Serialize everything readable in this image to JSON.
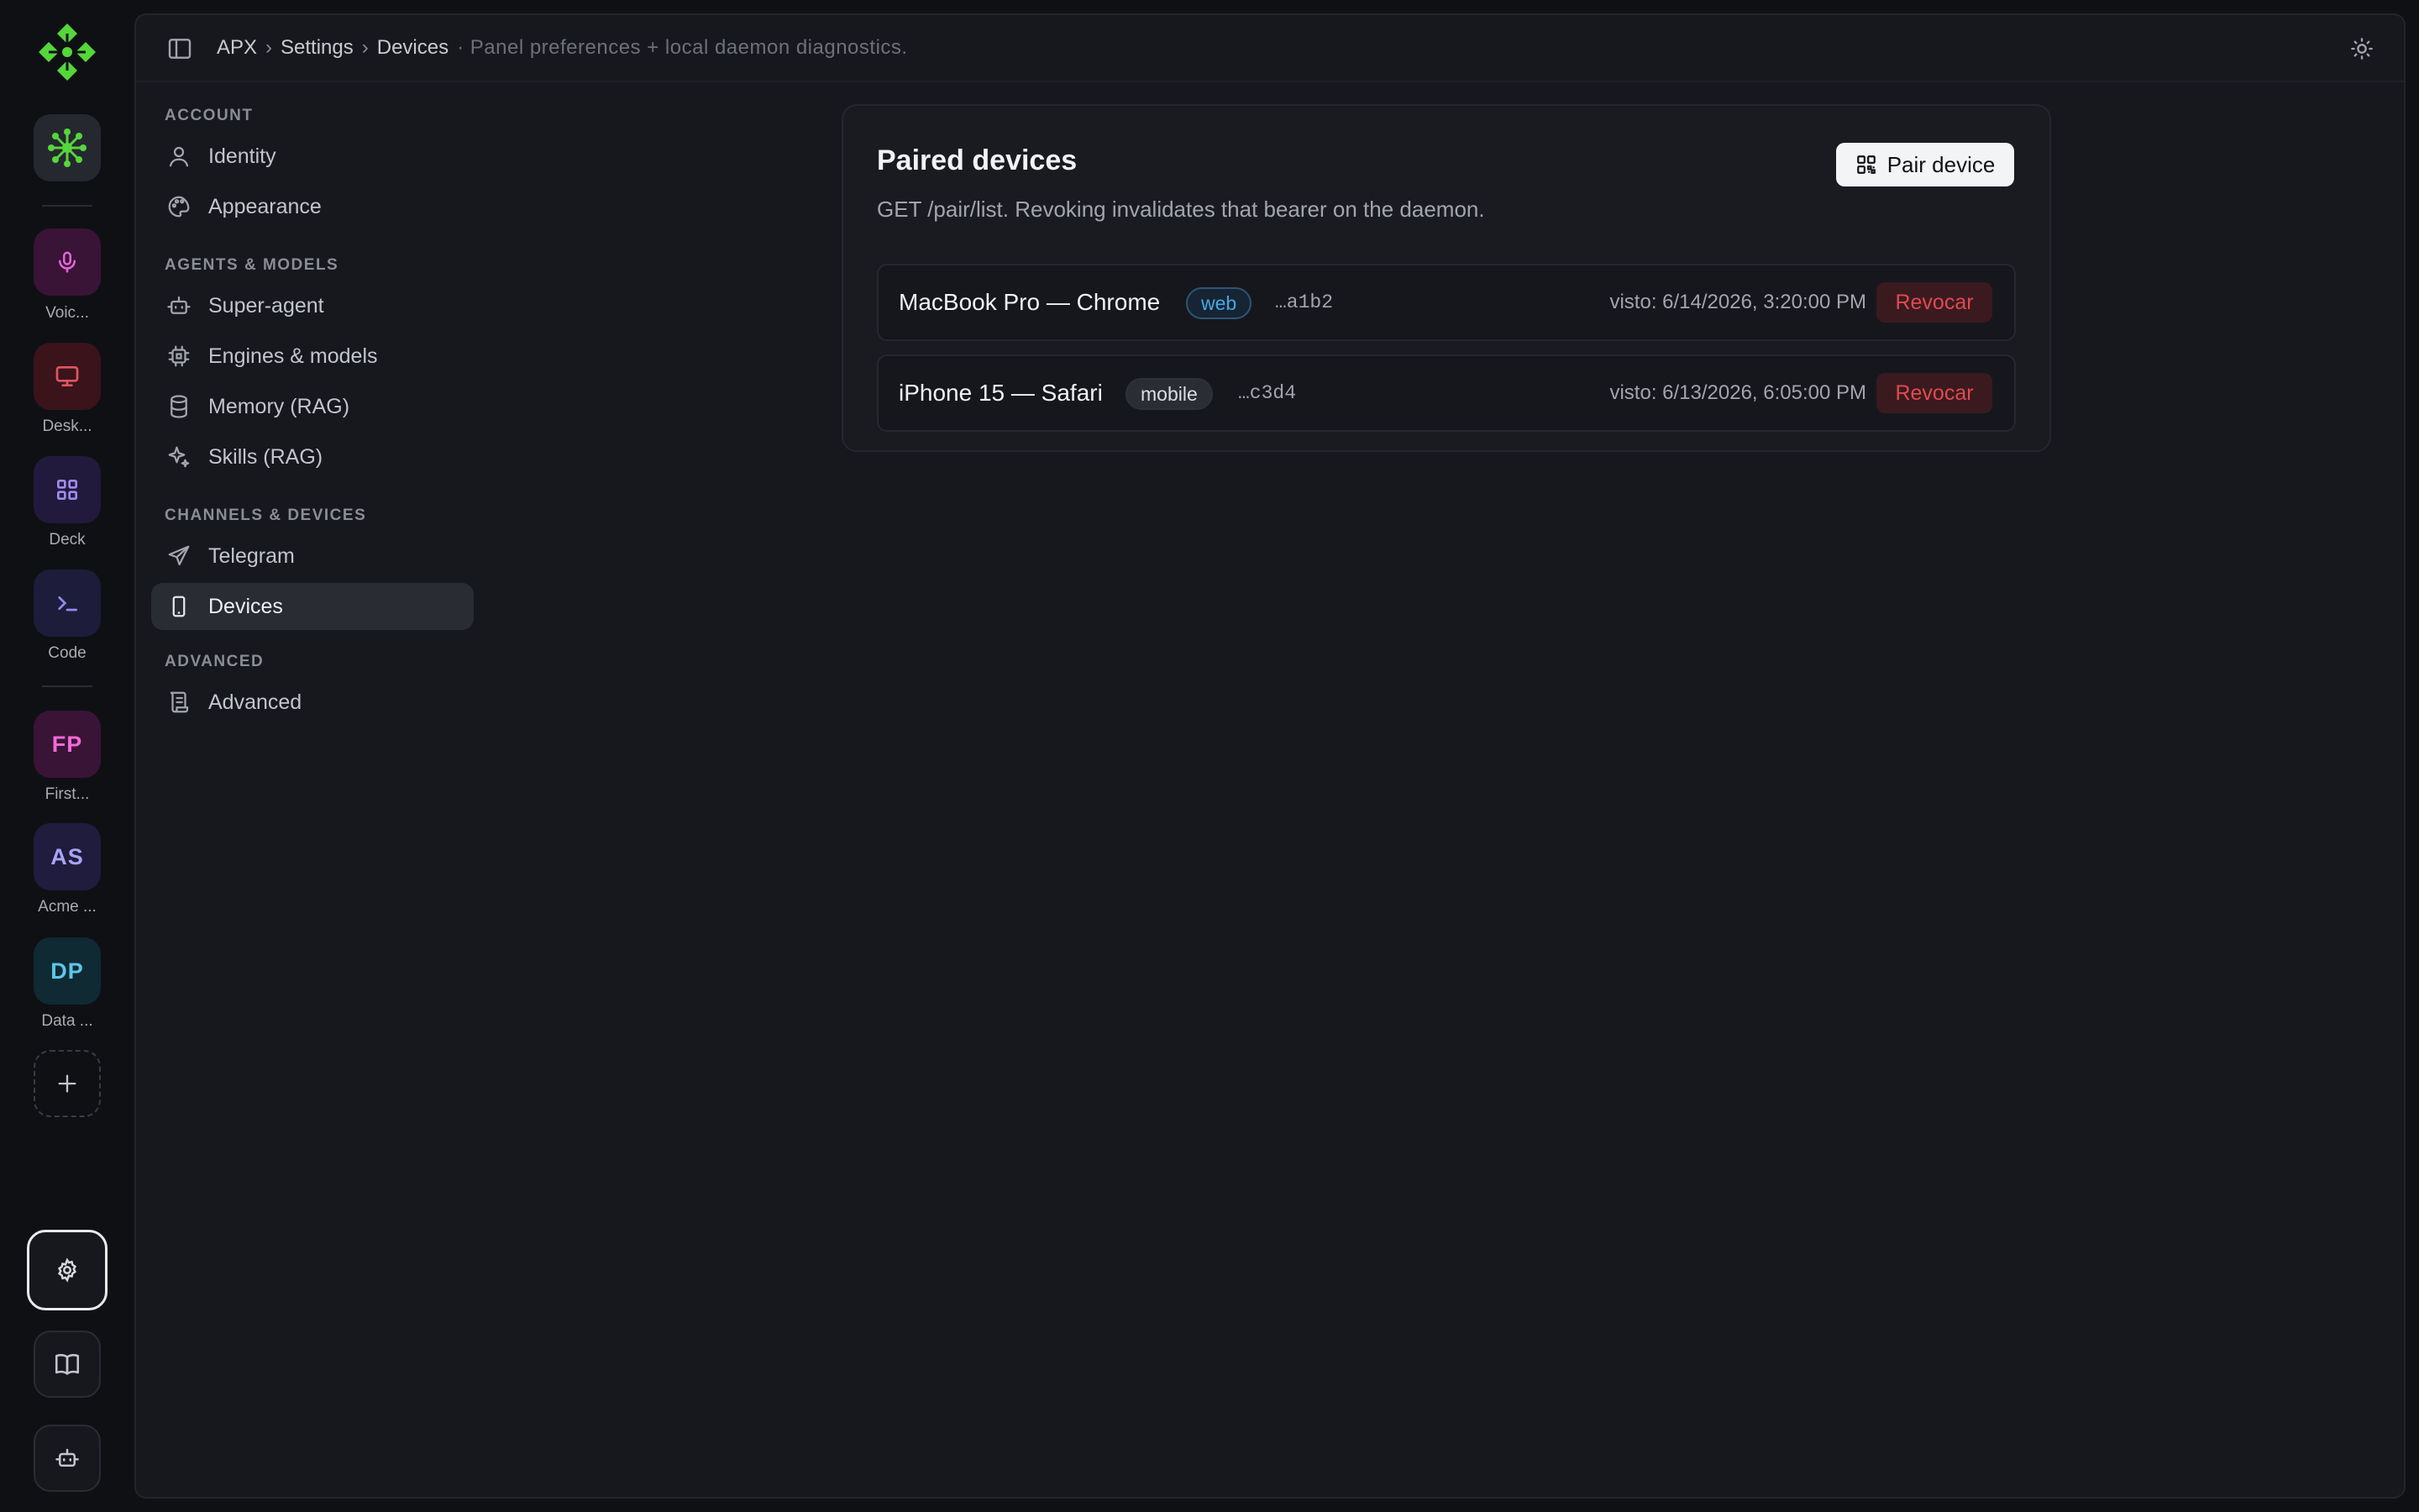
{
  "rail": {
    "projects": [
      {
        "initials": "FP",
        "label": "First...",
        "bg": "#3a1436",
        "fg": "#f06ad8"
      },
      {
        "initials": "AS",
        "label": "Acme ...",
        "bg": "#1f1c3e",
        "fg": "#a9a4f5"
      },
      {
        "initials": "DP",
        "label": "Data ...",
        "bg": "#0f2a33",
        "fg": "#5cc7ea"
      }
    ],
    "apps": [
      {
        "label": "Voic...",
        "icon": "microphone-icon"
      },
      {
        "label": "Desk...",
        "icon": "monitor-icon"
      },
      {
        "label": "Deck",
        "icon": "grid-icon"
      },
      {
        "label": "Code",
        "icon": "terminal-icon"
      }
    ]
  },
  "header": {
    "crumbs": [
      "APX",
      "Settings",
      "Devices"
    ],
    "separator": "›",
    "description": "· Panel preferences + local daemon diagnostics."
  },
  "nav": {
    "sections": [
      {
        "title": "ACCOUNT",
        "items": [
          "Identity",
          "Appearance"
        ]
      },
      {
        "title": "AGENTS & MODELS",
        "items": [
          "Super-agent",
          "Engines & models",
          "Memory (RAG)",
          "Skills (RAG)"
        ]
      },
      {
        "title": "CHANNELS & DEVICES",
        "items": [
          "Telegram",
          "Devices"
        ]
      },
      {
        "title": "ADVANCED",
        "items": [
          "Advanced"
        ]
      }
    ],
    "active": "Devices"
  },
  "card": {
    "title": "Paired devices",
    "subtitle": "GET /pair/list. Revoking invalidates that bearer on the daemon.",
    "pair_label": "Pair device",
    "devices": [
      {
        "name": "MacBook Pro — Chrome",
        "kind": "web",
        "token": "…a1b2",
        "seen": "visto: 6/14/2026, 3:20:00 PM",
        "revoke": "Revocar"
      },
      {
        "name": "iPhone 15 — Safari",
        "kind": "mobile",
        "token": "…c3d4",
        "seen": "visto: 6/13/2026, 6:05:00 PM",
        "revoke": "Revocar"
      }
    ]
  },
  "colors": {
    "brand": "#55d63a",
    "danger": "#e04a4f",
    "web_badge": "#45a9e6"
  }
}
